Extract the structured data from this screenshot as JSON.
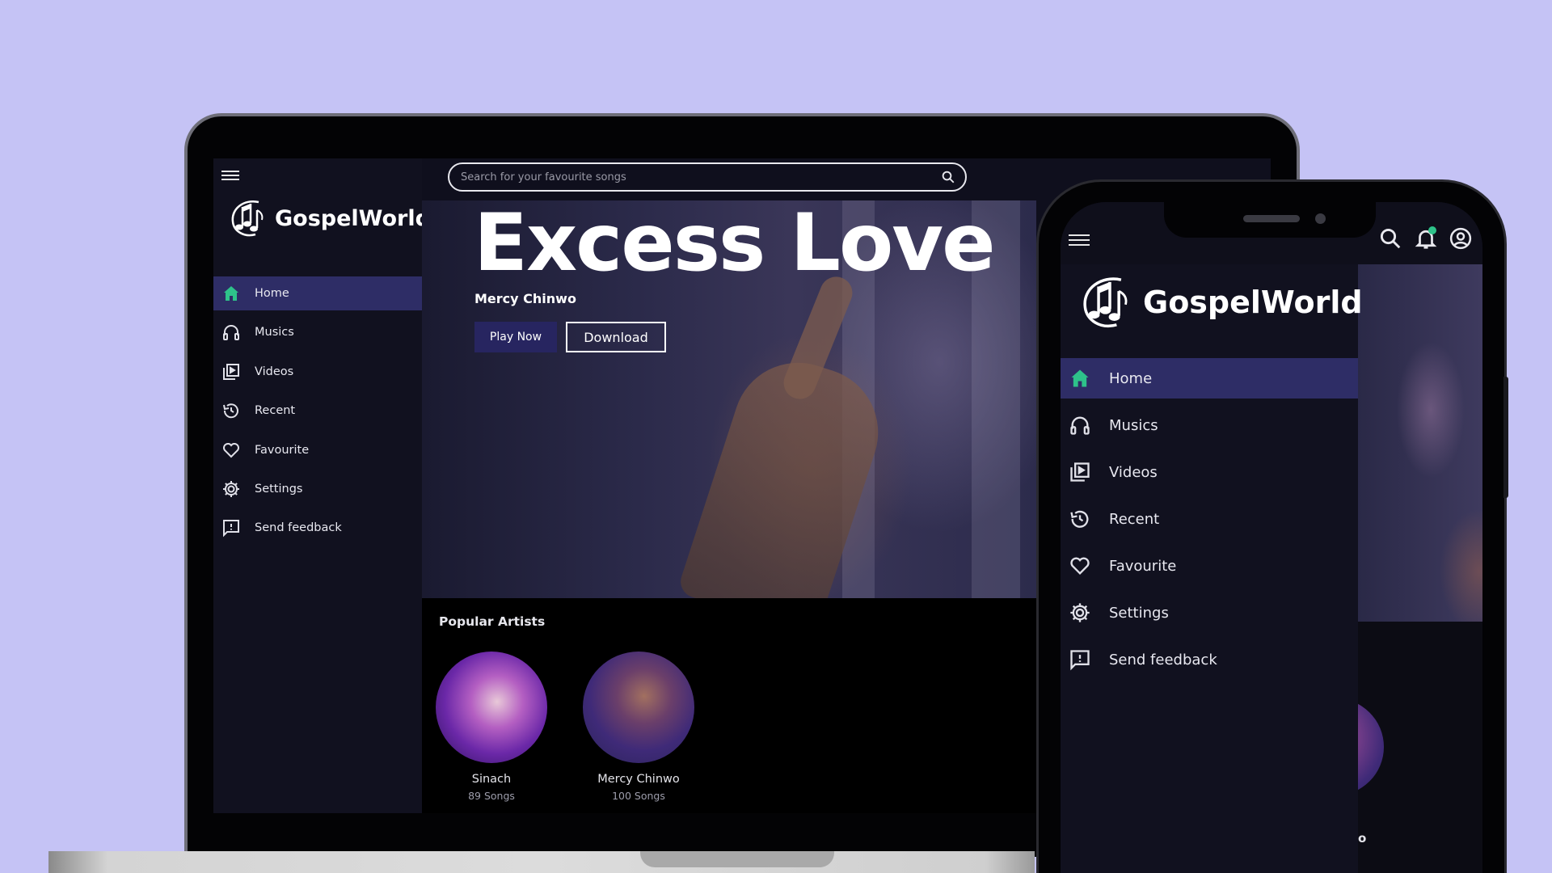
{
  "app": {
    "name": "GospelWorld"
  },
  "colors": {
    "accent_active_bg": "#2e2d66",
    "home_icon": "#2ec28a",
    "play_button": "#272560",
    "background": "#c5c3f5"
  },
  "search": {
    "placeholder": "Search for your favourite songs"
  },
  "nav": {
    "items": [
      {
        "label": "Home",
        "icon": "home-icon",
        "active": true
      },
      {
        "label": "Musics",
        "icon": "headphones-icon"
      },
      {
        "label": "Videos",
        "icon": "video-library-icon"
      },
      {
        "label": "Recent",
        "icon": "history-icon"
      },
      {
        "label": "Favourite",
        "icon": "heart-icon"
      },
      {
        "label": "Settings",
        "icon": "gear-icon"
      },
      {
        "label": "Send feedback",
        "icon": "feedback-icon"
      }
    ]
  },
  "hero": {
    "title": "Excess Love",
    "artist": "Mercy Chinwo",
    "play_label": "Play Now",
    "download_label": "Download"
  },
  "popular": {
    "title": "Popular Artists",
    "artists": [
      {
        "name": "Sinach",
        "count": "89 Songs"
      },
      {
        "name": "Mercy Chinwo",
        "count": "100 Songs"
      }
    ]
  },
  "phone": {
    "peek_text": "o"
  }
}
